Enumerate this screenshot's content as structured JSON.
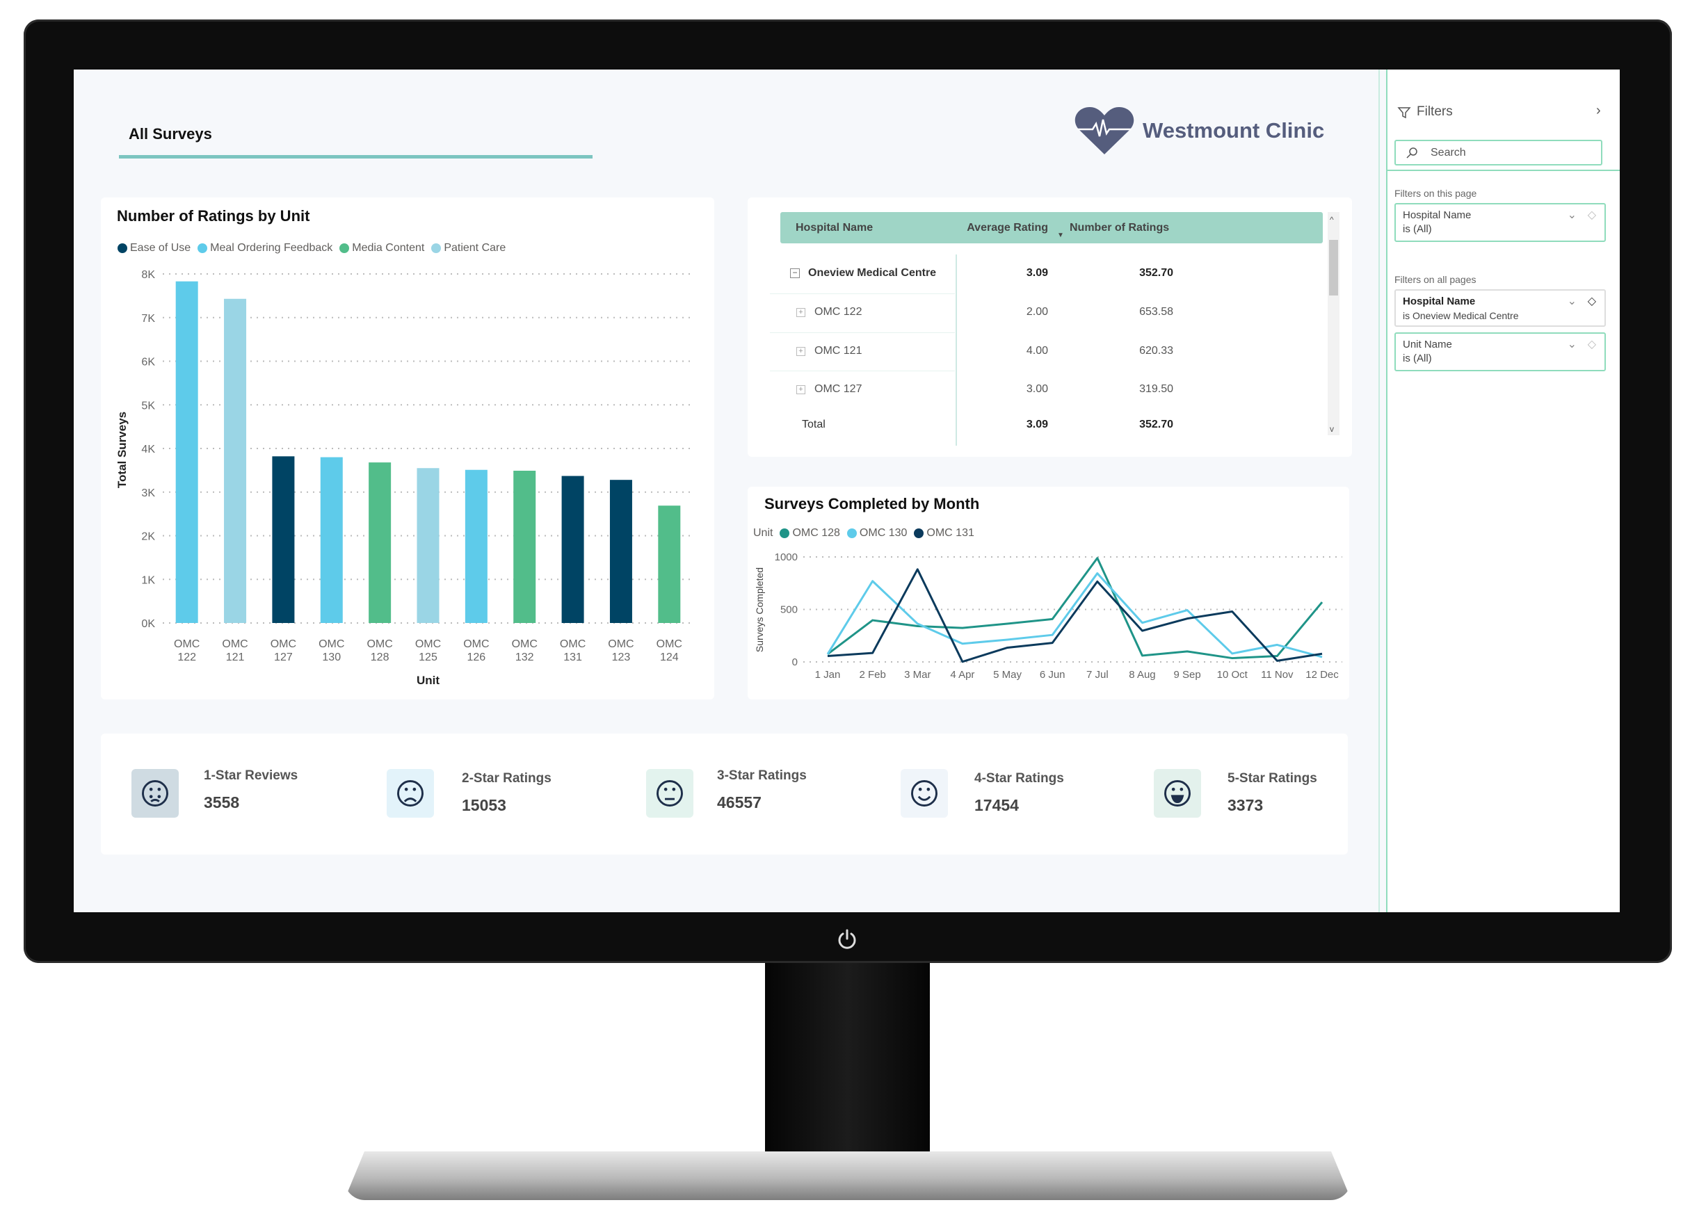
{
  "page": {
    "title": "All Surveys",
    "logo_text": "Westmount Clinic"
  },
  "colors": {
    "ease_of_use": "#004464",
    "meal_ordering_feedback": "#5ecbea",
    "media_content": "#52bd8a",
    "patient_care": "#9ad5e5",
    "omc128": "#1f9488",
    "omc130": "#5ecbea",
    "omc131": "#0b3a5c",
    "table_header": "#9fd5c6",
    "accent": "#7cc5c0"
  },
  "chart_data": [
    {
      "type": "bar",
      "title": "Number of Ratings by Unit",
      "xlabel": "Unit",
      "ylabel": "Total Surveys",
      "ylim": [
        0,
        8000
      ],
      "yticks": [
        "0K",
        "1K",
        "2K",
        "3K",
        "4K",
        "5K",
        "6K",
        "7K",
        "8K"
      ],
      "grid": true,
      "legend_placement": "top-left",
      "legend": [
        "Ease of Use",
        "Meal Ordering Feedback",
        "Media Content",
        "Patient Care"
      ],
      "categories": [
        "OMC 122",
        "OMC 121",
        "OMC 127",
        "OMC 130",
        "OMC 128",
        "OMC 125",
        "OMC 126",
        "OMC 132",
        "OMC 131",
        "OMC 123",
        "OMC 124"
      ],
      "values": [
        7830,
        7430,
        3820,
        3800,
        3680,
        3550,
        3510,
        3490,
        3370,
        3280,
        2690
      ],
      "bar_series": [
        "Meal Ordering Feedback",
        "Patient Care",
        "Ease of Use",
        "Meal Ordering Feedback",
        "Media Content",
        "Patient Care",
        "Meal Ordering Feedback",
        "Media Content",
        "Ease of Use",
        "Ease of Use",
        "Media Content"
      ]
    },
    {
      "type": "line",
      "title": "Surveys Completed by Month",
      "legend_title": "Unit",
      "ylabel": "Surveys Completed",
      "ylim": [
        0,
        1000
      ],
      "yticks": [
        "0",
        "500",
        "1000"
      ],
      "grid": true,
      "legend_placement": "top-left",
      "x": [
        "1 Jan",
        "2 Feb",
        "3 Mar",
        "4 Apr",
        "5 May",
        "6 Jun",
        "7 Jul",
        "8 Aug",
        "9 Sep",
        "10 Oct",
        "11 Nov",
        "12 Dec"
      ],
      "series": [
        {
          "name": "OMC 128",
          "values": [
            74,
            397,
            341,
            324,
            364,
            408,
            989,
            60,
            100,
            36,
            56,
            569
          ]
        },
        {
          "name": "OMC 130",
          "values": [
            74,
            770,
            364,
            174,
            212,
            257,
            844,
            373,
            493,
            80,
            163,
            47
          ]
        },
        {
          "name": "OMC 131",
          "values": [
            56,
            85,
            882,
            2,
            136,
            181,
            766,
            297,
            413,
            480,
            11,
            78
          ]
        }
      ]
    }
  ],
  "table": {
    "headers": [
      "Hospital Name",
      "Average Rating",
      "Number of Ratings"
    ],
    "rows": [
      {
        "name": "Oneview Medical Centre",
        "avg": "3.09",
        "num": "352.70"
      },
      {
        "name": "OMC 122",
        "avg": "2.00",
        "num": "653.58"
      },
      {
        "name": "OMC 121",
        "avg": "4.00",
        "num": "620.33"
      },
      {
        "name": "OMC 127",
        "avg": "3.00",
        "num": "319.50"
      },
      {
        "name": "Total",
        "avg": "3.09",
        "num": "352.70"
      }
    ]
  },
  "kpis": [
    {
      "label": "1-Star Reviews",
      "value": "3558",
      "icon": "crying-face-icon"
    },
    {
      "label": "2-Star Ratings",
      "value": "15053",
      "icon": "frown-face-icon"
    },
    {
      "label": "3-Star Ratings",
      "value": "46557",
      "icon": "neutral-face-icon"
    },
    {
      "label": "4-Star Ratings",
      "value": "17454",
      "icon": "smile-face-icon"
    },
    {
      "label": "5-Star Ratings",
      "value": "3373",
      "icon": "laughing-face-icon"
    }
  ],
  "filters": {
    "title": "Filters",
    "search_placeholder": "Search",
    "this_page_label": "Filters on this page",
    "all_pages_label": "Filters on all pages",
    "this_page": [
      {
        "field": "Hospital Name",
        "value": "is (All)"
      }
    ],
    "all_pages": [
      {
        "field": "Hospital Name",
        "value": "is Oneview Medical Centre"
      },
      {
        "field": "Unit Name",
        "value": "is (All)"
      }
    ]
  }
}
